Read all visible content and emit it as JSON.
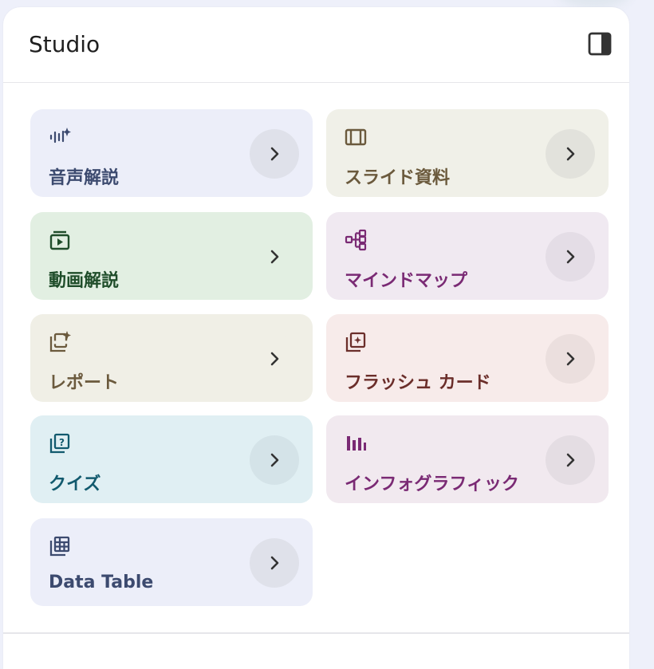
{
  "panel": {
    "title": "Studio",
    "toggle_icon": "panel-right-icon"
  },
  "cards": [
    {
      "id": "audio",
      "label": "音声解説",
      "icon": "audio-sparkle-icon",
      "bg": "#eceef9",
      "fg": "#3c4a6f",
      "arrow_bg": "#dfe1ea"
    },
    {
      "id": "slides",
      "label": "スライド資料",
      "icon": "slides-icon",
      "bg": "#f0f0e8",
      "fg": "#6b5a3d",
      "arrow_bg": "#e2e2dc"
    },
    {
      "id": "video",
      "label": "動画解説",
      "icon": "video-icon",
      "bg": "#e2efe2",
      "fg": "#1f4d2a",
      "arrow_bg": "#e2efe2"
    },
    {
      "id": "mindmap",
      "label": "マインドマップ",
      "icon": "mindmap-icon",
      "bg": "#f0e9f1",
      "fg": "#7a2a74",
      "arrow_bg": "#e4dde6"
    },
    {
      "id": "report",
      "label": "レポート",
      "icon": "report-icon",
      "bg": "#f0efe6",
      "fg": "#6b5a3d",
      "arrow_bg": "#f0efe6"
    },
    {
      "id": "flashcards",
      "label": "フラッシュ カード",
      "icon": "flashcards-icon",
      "bg": "#f7ebea",
      "fg": "#6b2e2a",
      "arrow_bg": "#ebdfde"
    },
    {
      "id": "quiz",
      "label": "クイズ",
      "icon": "quiz-icon",
      "bg": "#e0eff3",
      "fg": "#125a6e",
      "arrow_bg": "#d4e3e8"
    },
    {
      "id": "infographic",
      "label": "インフォグラフィック",
      "icon": "infographic-icon",
      "bg": "#f1e9ef",
      "fg": "#7a2a74",
      "arrow_bg": "#e4dde3"
    },
    {
      "id": "datatable",
      "label": "Data Table",
      "icon": "table-icon",
      "bg": "#eceef9",
      "fg": "#3c4a6f",
      "arrow_bg": "#dfe1ea"
    }
  ],
  "arrow_icon": "chevron-right-icon"
}
